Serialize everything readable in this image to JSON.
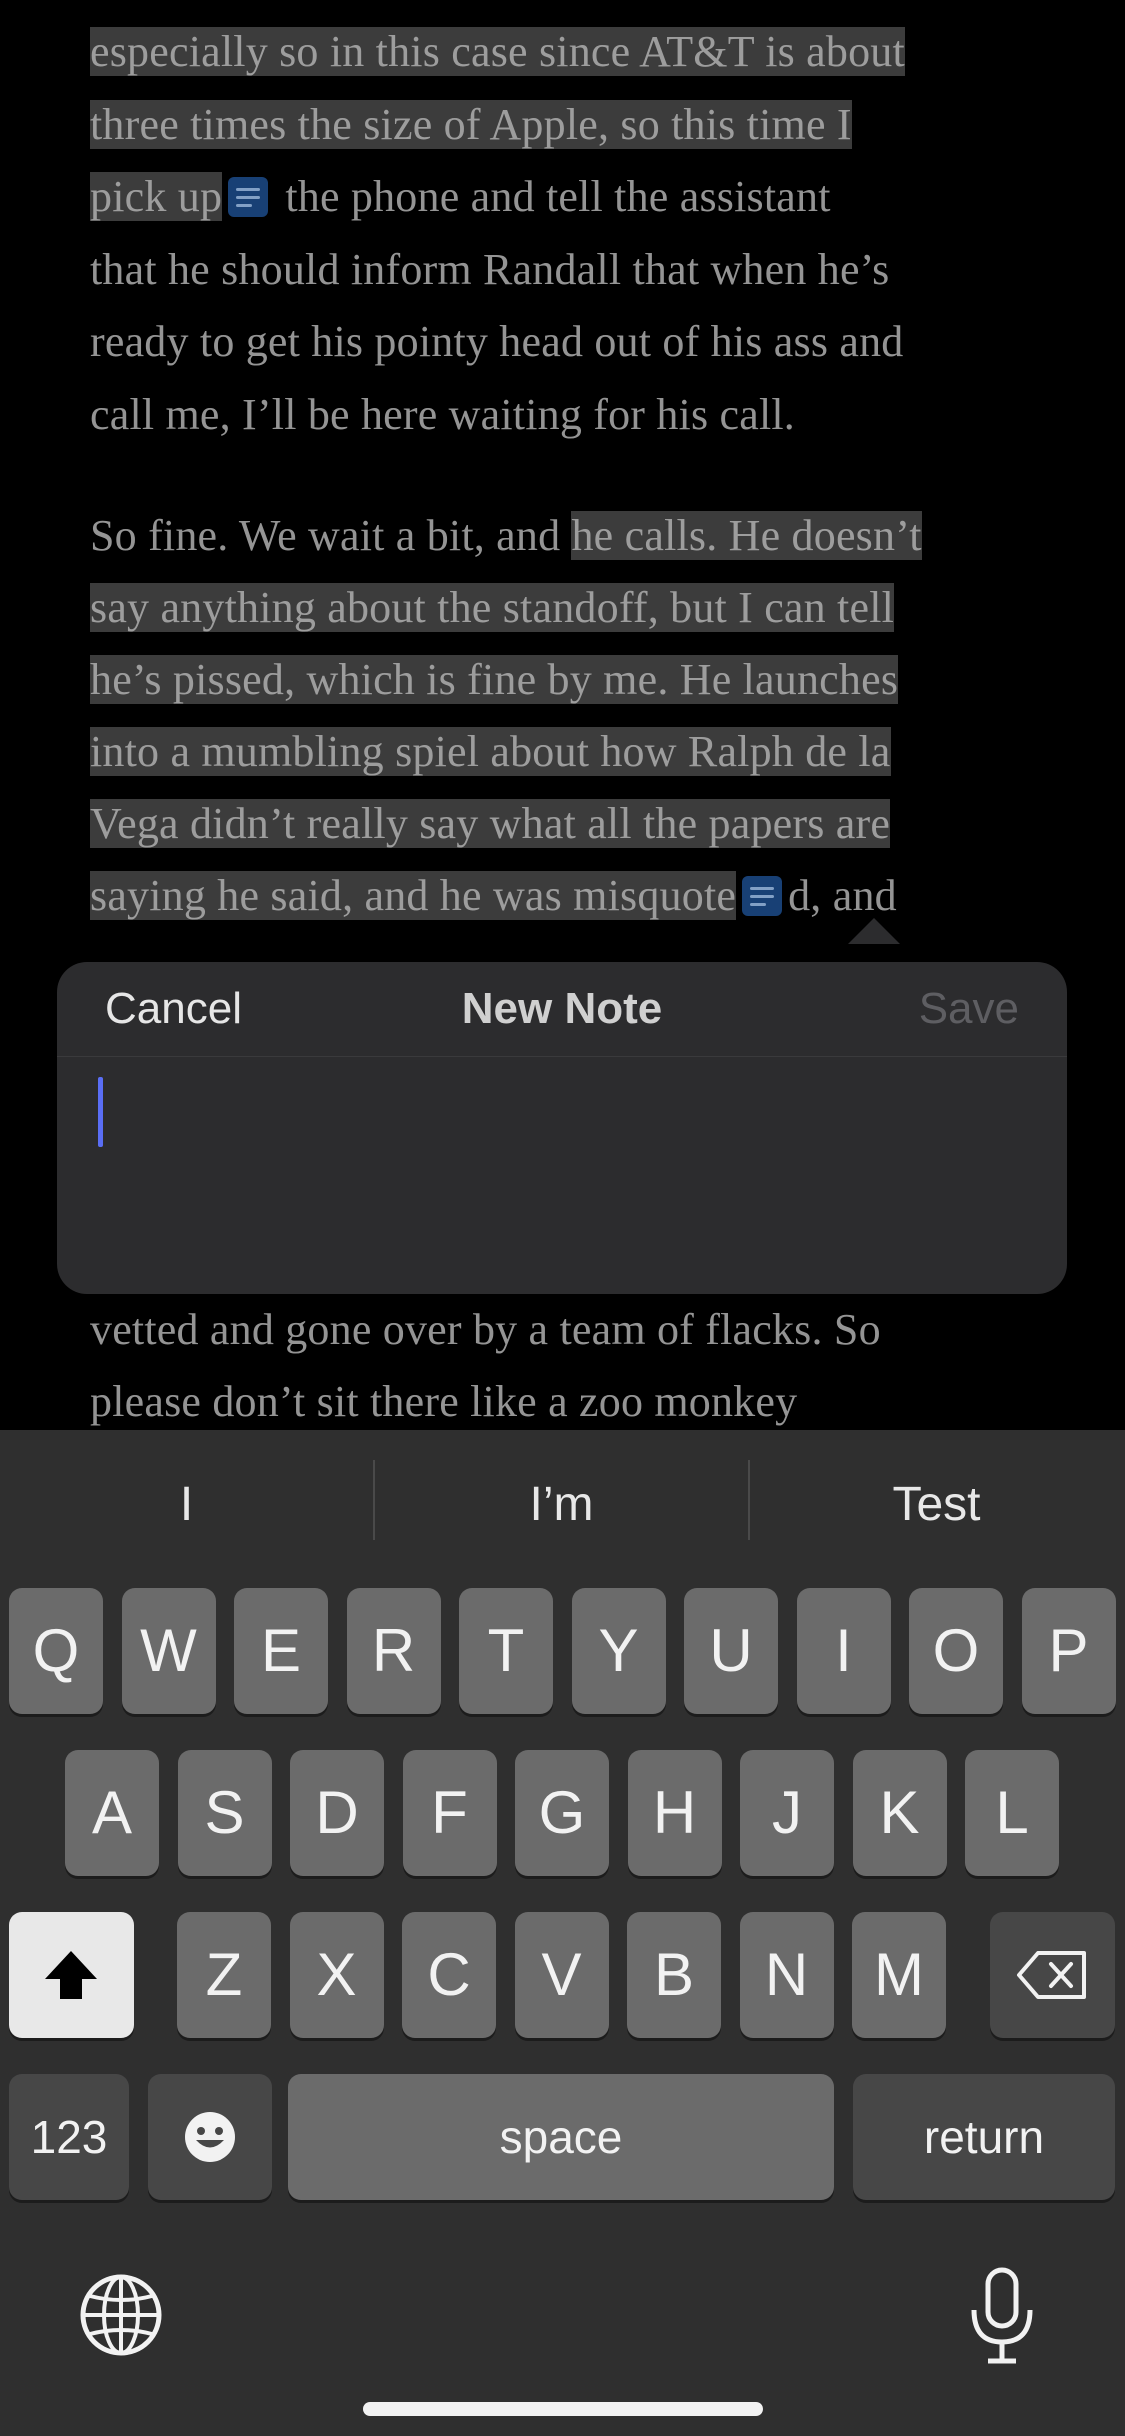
{
  "reader": {
    "paragraph1": [
      {
        "segments": [
          {
            "text": "especially so in this case since AT&T is about",
            "hl": true
          }
        ]
      },
      {
        "segments": [
          {
            "text": "three times the size of Apple, so this time I",
            "hl": true
          }
        ]
      },
      {
        "segments": [
          {
            "text": "pick up",
            "hl": true
          },
          {
            "marker": true
          },
          {
            "text": " the phone and tell the assistant",
            "hl": false
          }
        ]
      },
      {
        "segments": [
          {
            "text": "that he should inform Randall that when he’s",
            "hl": false
          }
        ]
      },
      {
        "segments": [
          {
            "text": "ready to get his pointy head out of his ass and",
            "hl": false
          }
        ]
      },
      {
        "segments": [
          {
            "text": "call me, I’ll be here waiting for his call.",
            "hl": false
          }
        ]
      }
    ],
    "paragraph2": [
      {
        "segments": [
          {
            "text": "So fine. We wait a bit, and ",
            "hl": false
          },
          {
            "text": "he calls. He doesn’t",
            "hl": true
          }
        ]
      },
      {
        "segments": [
          {
            "text": "say anything about the standoff, but I can tell",
            "hl": true
          }
        ]
      },
      {
        "segments": [
          {
            "text": "he’s pissed, which is fine by me. He launches",
            "hl": true
          }
        ]
      },
      {
        "segments": [
          {
            "text": "into a mumbling spiel about how Ralph de la",
            "hl": true
          }
        ]
      },
      {
        "segments": [
          {
            "text": "Vega didn’t really say what all the papers are",
            "hl": true
          }
        ]
      },
      {
        "segments": [
          {
            "text": "saying he said, and he was misquote",
            "hl": true
          },
          {
            "marker": true
          },
          {
            "text": "d, and",
            "hl": false
          }
        ]
      }
    ],
    "paragraph3": [
      {
        "segments": [
          {
            "text": "vetted and gone over by a team of flacks. So",
            "hl": false
          }
        ]
      },
      {
        "segments": [
          {
            "text": "please don’t sit there like a zoo monkey",
            "hl": false
          }
        ]
      }
    ]
  },
  "popup": {
    "cancel": "Cancel",
    "title": "New Note",
    "save": "Save",
    "note_text": ""
  },
  "keyboard": {
    "suggestions": [
      "I",
      "I’m",
      "Test"
    ],
    "row1": [
      "Q",
      "W",
      "E",
      "R",
      "T",
      "Y",
      "U",
      "I",
      "O",
      "P"
    ],
    "row2": [
      "A",
      "S",
      "D",
      "F",
      "G",
      "H",
      "J",
      "K",
      "L"
    ],
    "row3": [
      "Z",
      "X",
      "C",
      "V",
      "B",
      "N",
      "M"
    ],
    "numbers_label": "123",
    "space_label": "space",
    "return_label": "return",
    "icons": {
      "shift": "shift-icon",
      "delete": "delete-icon",
      "emoji": "emoji-icon",
      "globe": "globe-icon",
      "mic": "microphone-icon"
    }
  },
  "colors": {
    "highlight": "#4a4a4a",
    "note_marker": "#1e4f8f",
    "caret": "#5a6ef5",
    "keyboard_bg": "#2f2f2f",
    "key": "#6b6b6b"
  }
}
